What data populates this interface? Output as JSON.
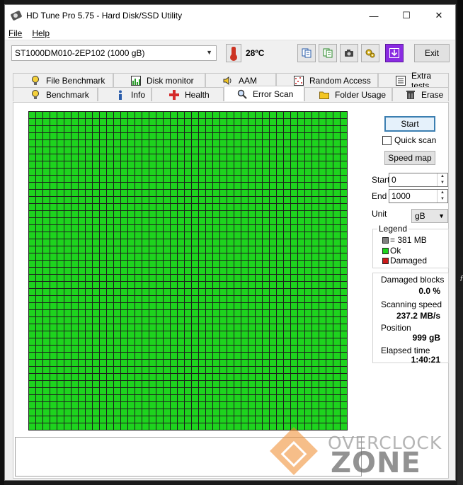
{
  "window": {
    "title": "HD Tune Pro 5.75 - Hard Disk/SSD Utility",
    "controls": {
      "minimize": "—",
      "maximize": "☐",
      "close": "✕"
    }
  },
  "menu": [
    {
      "label": "File",
      "underline": "F"
    },
    {
      "label": "Help",
      "underline": "H"
    }
  ],
  "toolbar": {
    "drive": "ST1000DM010-2EP102 (1000 gB)",
    "temperature": "28ºC",
    "buttons": [
      "copy-info-icon",
      "copy-text-icon",
      "screenshot-icon",
      "settings-icon",
      "save-icon"
    ],
    "exit_label": "Exit"
  },
  "tabs": {
    "row1": [
      {
        "label": "File Benchmark",
        "icon": "file-benchmark-icon"
      },
      {
        "label": "Disk monitor",
        "icon": "disk-monitor-icon"
      },
      {
        "label": "AAM",
        "icon": "speaker-icon"
      },
      {
        "label": "Random Access",
        "icon": "random-access-icon"
      },
      {
        "label": "Extra tests",
        "icon": "extra-tests-icon"
      }
    ],
    "row2": [
      {
        "label": "Benchmark",
        "icon": "lightbulb-icon"
      },
      {
        "label": "Info",
        "icon": "info-icon"
      },
      {
        "label": "Health",
        "icon": "health-cross-icon"
      },
      {
        "label": "Error Scan",
        "icon": "magnifier-icon",
        "active": true
      },
      {
        "label": "Folder Usage",
        "icon": "folder-icon"
      },
      {
        "label": "Erase",
        "icon": "trash-icon"
      }
    ]
  },
  "scan": {
    "grid_rows": 45,
    "grid_cols": 45,
    "block_status": "ok",
    "colors": {
      "ok": "#1ed31e",
      "damaged": "#cc1b1b",
      "untested": "#808080"
    }
  },
  "controls": {
    "start_label": "Start",
    "quick_scan_label": "Quick scan",
    "quick_scan_checked": false,
    "speed_map_label": "Speed map",
    "start_field_label": "Start",
    "start_value": "0",
    "end_field_label": "End",
    "end_value": "1000",
    "unit_label": "Unit",
    "unit_value": "gB"
  },
  "legend": {
    "title": "Legend",
    "items": [
      {
        "label": "= 381 MB",
        "color": "#808080"
      },
      {
        "label": "Ok",
        "color": "#1ed31e"
      },
      {
        "label": "Damaged",
        "color": "#cc1b1b"
      }
    ]
  },
  "stats": {
    "damaged_label": "Damaged blocks",
    "damaged_value": "0.0 %",
    "speed_label": "Scanning speed",
    "speed_value": "237.2 MB/s",
    "position_label": "Position",
    "position_value": "999 gB",
    "elapsed_label": "Elapsed time",
    "elapsed_value": "1:40:21"
  },
  "watermark": {
    "line1": "OVERCLOCK",
    "line2": "ZONE"
  },
  "background": {
    "edge_text": "f"
  }
}
